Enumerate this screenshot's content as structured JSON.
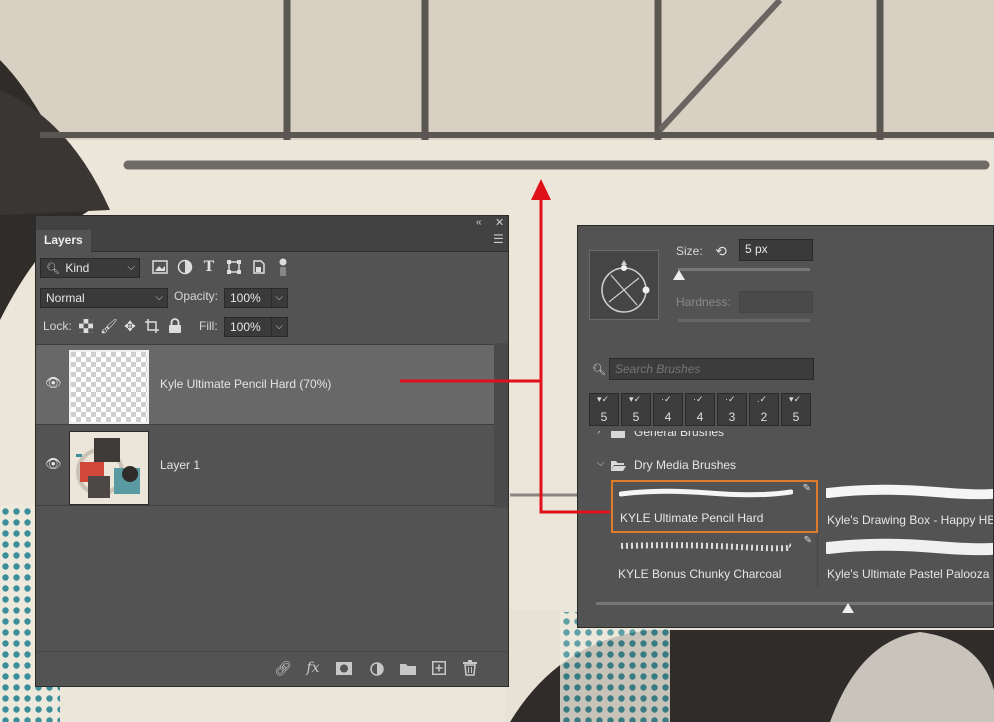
{
  "layers_panel": {
    "tab_label": "Layers",
    "filter_kind": "Kind",
    "blend_mode": "Normal",
    "opacity_label": "Opacity:",
    "opacity_value": "100%",
    "lock_label": "Lock:",
    "fill_label": "Fill:",
    "fill_value": "100%",
    "layers": [
      {
        "name": "Kyle Ultimate Pencil Hard (70%)",
        "selected": true,
        "visible": true
      },
      {
        "name": "Layer 1",
        "selected": false,
        "visible": true
      }
    ],
    "bottom_icons": [
      "link-icon",
      "fx-icon",
      "mask-icon",
      "adjustment-icon",
      "folder-icon",
      "new-layer-icon",
      "trash-icon"
    ],
    "fx_label": "fx"
  },
  "brush_panel": {
    "size_label": "Size:",
    "size_value": "5 px",
    "hardness_label": "Hardness:",
    "search_placeholder": "Search Brushes",
    "preset_sizes": [
      "5",
      "5",
      "4",
      "4",
      "3",
      "2",
      "5"
    ],
    "group_general": "General Brushes",
    "group_dry_media": "Dry Media Brushes",
    "brushes": [
      {
        "name": "KYLE Ultimate Pencil Hard",
        "selected": true
      },
      {
        "name": "Kyle's Drawing Box - Happy HB",
        "selected": false
      },
      {
        "name": "KYLE Bonus Chunky Charcoal",
        "selected": false
      },
      {
        "name": "Kyle's Ultimate Pastel Palooza",
        "selected": false
      }
    ]
  },
  "colors": {
    "panel_bg": "#535353",
    "field_bg": "#3a3a3a",
    "selected_layer": "#6a6a6a",
    "selection_outline": "#e07b28",
    "annotation_red": "#e0101a"
  }
}
